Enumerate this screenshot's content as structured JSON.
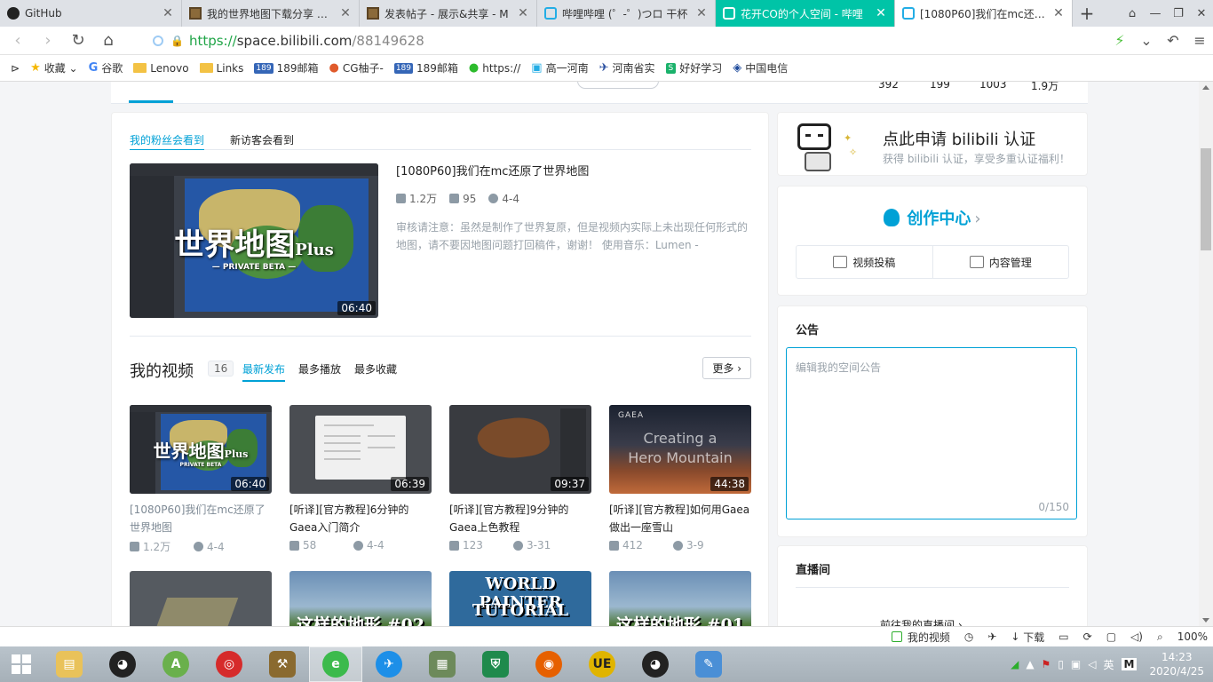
{
  "tabs": [
    {
      "title": "GitHub",
      "icon": "github-icon"
    },
    {
      "title": "我的世界地图下载分享 展示",
      "icon": "minecraft-icon"
    },
    {
      "title": "发表帖子 - 展示&共享 - M",
      "icon": "minecraft-icon"
    },
    {
      "title": "哔哩哔哩 (゜-゜)つロ 干杯",
      "icon": "bilibili-icon"
    },
    {
      "title": "花开CO的个人空间 - 哔哩",
      "icon": "bilibili-icon"
    },
    {
      "title": "[1080P60]我们在mc还原了",
      "icon": "bilibili-icon"
    }
  ],
  "address": {
    "protocol": "https://",
    "domain": "space.bilibili.com",
    "path": "/88149628"
  },
  "bookmarks": [
    {
      "label": "收藏",
      "icon": "star-icon"
    },
    {
      "label": "谷歌",
      "icon": "google-icon"
    },
    {
      "label": "Lenovo",
      "icon": "folder-icon"
    },
    {
      "label": "Links",
      "icon": "folder-icon"
    },
    {
      "label": "189邮箱",
      "icon": "mail189-icon"
    },
    {
      "label": "CG柚子-",
      "icon": "cg-icon"
    },
    {
      "label": "189邮箱",
      "icon": "mail189-icon"
    },
    {
      "label": "https://",
      "icon": "wechat-icon"
    },
    {
      "label": "高一河南",
      "icon": "bilibili-icon"
    },
    {
      "label": "河南省实",
      "icon": "school-icon"
    },
    {
      "label": "好好学习",
      "icon": "s-icon"
    },
    {
      "label": "中国电信",
      "icon": "telecom-icon"
    }
  ],
  "top_stats": [
    "392",
    "199",
    "1003",
    "1.9万"
  ],
  "subtabs": [
    "我的粉丝会看到",
    "新访客会看到"
  ],
  "featured": {
    "thumb_title": "世界地图",
    "thumb_plus": "Plus",
    "thumb_sub": "— PRIVATE  BETA —",
    "duration": "06:40",
    "title": "[1080P60]我们在mc还原了世界地图",
    "views": "1.2万",
    "comments": "95",
    "date": "4-4",
    "desc": "审核请注意：虽然是制作了世界复原，但是视频内实际上未出现任何形式的地图，请不要因地图问题打回稿件，谢谢！ 使用音乐：Lumen -"
  },
  "myvideo": {
    "title": "我的视频",
    "count": "16",
    "sorts": [
      "最新发布",
      "最多播放",
      "最多收藏"
    ],
    "more": "更多"
  },
  "videos": [
    {
      "duration": "06:40",
      "title": "[1080P60]我们在mc还原了世界地图",
      "views": "1.2万",
      "date": "4-4",
      "visited": true,
      "type": "map",
      "thumb_title": "世界地图",
      "thumb_plus": "Plus",
      "thumb_sub": "PRIVATE  BETA"
    },
    {
      "duration": "06:39",
      "title": "[听译][官方教程]6分钟的Gaea入门简介",
      "views": "58",
      "date": "4-4",
      "visited": false,
      "type": "dialog"
    },
    {
      "duration": "09:37",
      "title": "[听译][官方教程]9分钟的Gaea上色教程",
      "views": "123",
      "date": "3-31",
      "visited": false,
      "type": "terrain"
    },
    {
      "duration": "44:38",
      "title": "[听译][官方教程]如何用Gaea做出一座雪山",
      "views": "412",
      "date": "3-9",
      "visited": false,
      "type": "gaea",
      "thumb_logo": "GAEA",
      "thumb_line1": "Creating a",
      "thumb_line2": "Hero Mountain"
    }
  ],
  "videos_row2": [
    {
      "type": "terrain3d"
    },
    {
      "type": "mc",
      "text": "这样的地形 #02"
    },
    {
      "type": "wp",
      "line1": "WORLD PAINTER",
      "line2": "TUTORIAL"
    },
    {
      "type": "mc",
      "text": "这样的地形 #01"
    }
  ],
  "cert": {
    "title": "点此申请 bilibili 认证",
    "sub": "获得 bilibili 认证，享受多重认证福利！"
  },
  "creator": {
    "title": "创作中心",
    "btn_upload": "视频投稿",
    "btn_manage": "内容管理"
  },
  "notice": {
    "label": "公告",
    "placeholder": "编辑我的空间公告",
    "count": "0/150"
  },
  "live": {
    "label": "直播间",
    "link": "前往我的直播间"
  },
  "statusbar": [
    "我的视频",
    "下载",
    "100%"
  ],
  "taskbar": {
    "apps": [
      "qq",
      "android-studio",
      "netease-music",
      "shovel",
      "360-browser",
      "feishu",
      "photos",
      "vpn-shield",
      "firefox",
      "unreal",
      "qq2",
      "paint"
    ],
    "ime": "英",
    "time": "14:23",
    "date": "2020/4/25"
  },
  "colors": {
    "accent": "#00a1d6",
    "tab_active": "#00c4a7",
    "url_green": "#1ea446"
  }
}
